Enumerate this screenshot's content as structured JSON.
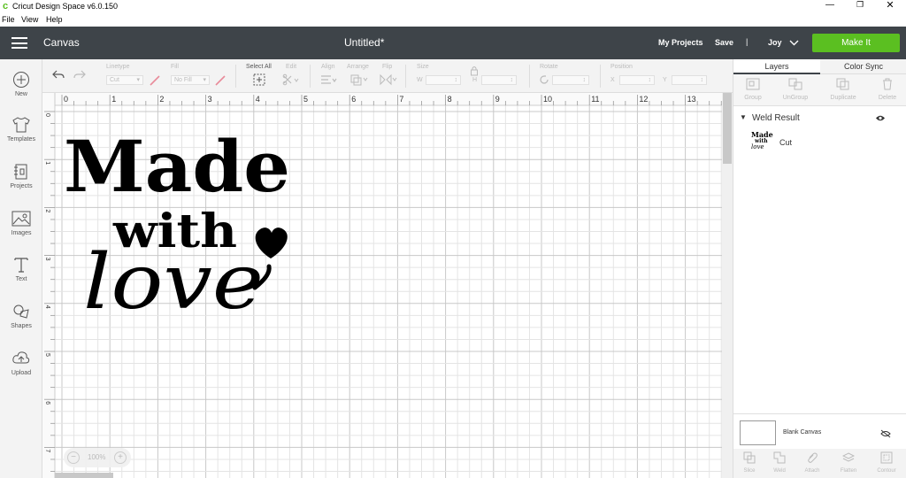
{
  "window": {
    "title": "Cricut Design Space  v6.0.150"
  },
  "menu": [
    "File",
    "View",
    "Help"
  ],
  "header": {
    "canvas_label": "Canvas",
    "doc_title": "Untitled*",
    "my_projects": "My Projects",
    "save": "Save",
    "separator": "|",
    "user": "Joy",
    "make_it": "Make It"
  },
  "toolbar": {
    "linetype_label": "Linetype",
    "linetype_value": "Cut",
    "fill_label": "Fill",
    "fill_value": "No Fill",
    "select_all": "Select All",
    "edit": "Edit",
    "align": "Align",
    "arrange": "Arrange",
    "flip": "Flip",
    "size": "Size",
    "w": "W",
    "h": "H",
    "rotate": "Rotate",
    "position": "Position",
    "x": "X",
    "y": "Y"
  },
  "leftbar": [
    {
      "label": "New",
      "icon": "plus-circle-icon"
    },
    {
      "label": "Templates",
      "icon": "tshirt-icon"
    },
    {
      "label": "Projects",
      "icon": "projects-icon"
    },
    {
      "label": "Images",
      "icon": "image-icon"
    },
    {
      "label": "Text",
      "icon": "text-icon"
    },
    {
      "label": "Shapes",
      "icon": "shapes-icon"
    },
    {
      "label": "Upload",
      "icon": "upload-cloud-icon"
    }
  ],
  "ruler": {
    "top": [
      "0",
      "1",
      "2",
      "3",
      "4",
      "5",
      "6",
      "7",
      "8",
      "9",
      "10",
      "11",
      "12",
      "13"
    ],
    "left": [
      "0",
      "1",
      "2",
      "3",
      "4",
      "5",
      "6",
      "7"
    ]
  },
  "design": {
    "line1": "Made",
    "line2": "with",
    "line3": "love"
  },
  "zoom": {
    "value": "100%"
  },
  "panel": {
    "tab_layers": "Layers",
    "tab_color_sync": "Color Sync",
    "actions": [
      "Group",
      "UnGroup",
      "Duplicate",
      "Delete"
    ],
    "weld_result": "Weld Result",
    "layer_name": "Cut",
    "thumb_text": [
      "Made",
      "with",
      "love"
    ],
    "blank_canvas": "Blank Canvas",
    "bottom_actions": [
      "Slice",
      "Weld",
      "Attach",
      "Flatten",
      "Contour"
    ]
  },
  "colors": {
    "header_bg": "#3e4449",
    "make_it": "#5bbf21",
    "logo": "#5bbf21"
  }
}
